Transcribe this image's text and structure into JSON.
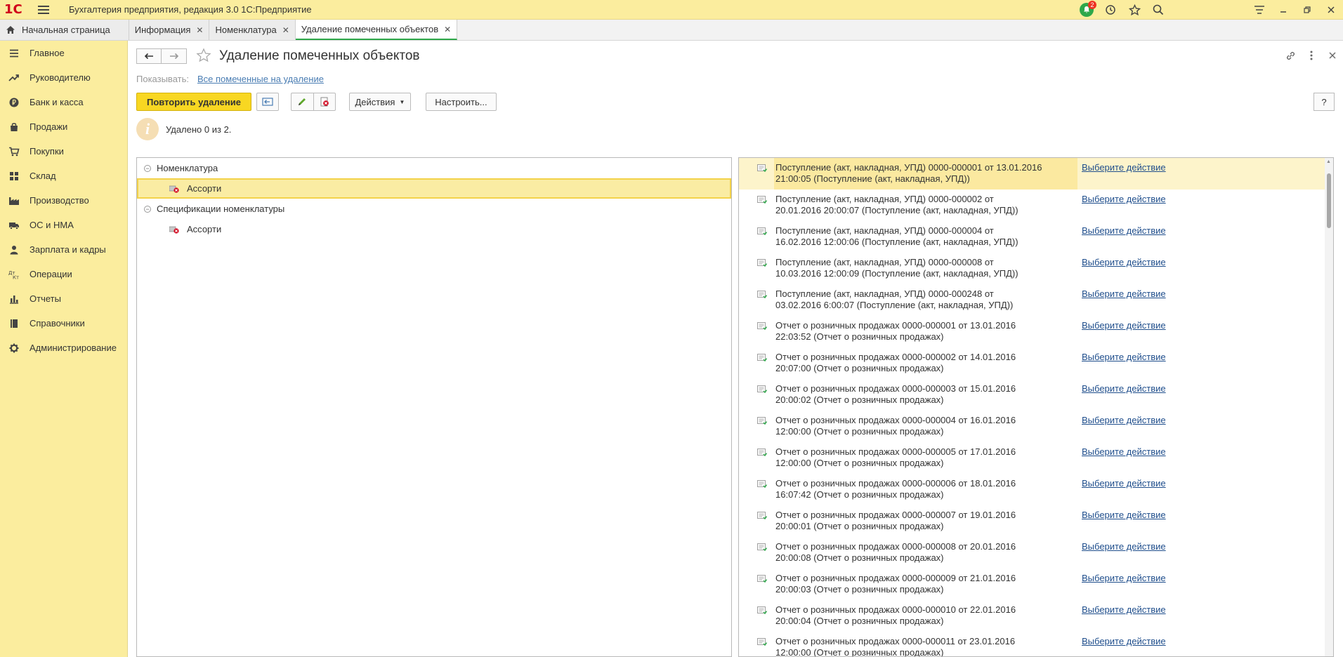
{
  "app": {
    "title": "Бухгалтерия предприятия, редакция 3.0 1С:Предприятие",
    "logo": "1С",
    "notifications_count": "2"
  },
  "tabs": [
    {
      "label": "Начальная страница"
    },
    {
      "label": "Информация"
    },
    {
      "label": "Номенклатура"
    },
    {
      "label": "Удаление помеченных объектов"
    }
  ],
  "sidebar": {
    "items": [
      {
        "label": "Главное",
        "icon": "menu-lines-icon"
      },
      {
        "label": "Руководителю",
        "icon": "trend-icon"
      },
      {
        "label": "Банк и касса",
        "icon": "ruble-icon"
      },
      {
        "label": "Продажи",
        "icon": "bag-icon"
      },
      {
        "label": "Покупки",
        "icon": "cart-icon"
      },
      {
        "label": "Склад",
        "icon": "grid-icon"
      },
      {
        "label": "Производство",
        "icon": "factory-icon"
      },
      {
        "label": "ОС и НМА",
        "icon": "truck-icon"
      },
      {
        "label": "Зарплата и кадры",
        "icon": "person-icon"
      },
      {
        "label": "Операции",
        "icon": "dt-kt-icon"
      },
      {
        "label": "Отчеты",
        "icon": "bar-chart-icon"
      },
      {
        "label": "Справочники",
        "icon": "book-icon"
      },
      {
        "label": "Администрирование",
        "icon": "gear-icon"
      }
    ]
  },
  "main": {
    "title": "Удаление помеченных объектов",
    "show_label": "Показывать:",
    "show_link": "Все помеченные на удаление",
    "toolbar": {
      "retry_label": "Повторить удаление",
      "actions_label": "Действия",
      "settings_label": "Настроить...",
      "help_label": "?"
    },
    "info_text": "Удалено 0 из 2.",
    "tree": [
      {
        "label": "Номенклатура",
        "level": 0
      },
      {
        "label": "Ассорти",
        "level": 1,
        "selected": true
      },
      {
        "label": "Спецификации номенклатуры",
        "level": 0
      },
      {
        "label": "Ассорти",
        "level": 1
      }
    ],
    "documents": [
      {
        "text": "Поступление (акт, накладная, УПД) 0000-000001 от 13.01.2016 21:00:05 (Поступление (акт, накладная, УПД))",
        "action": "Выберите действие"
      },
      {
        "text": "Поступление (акт, накладная, УПД) 0000-000002 от 20.01.2016 20:00:07 (Поступление (акт, накладная, УПД))",
        "action": "Выберите действие"
      },
      {
        "text": "Поступление (акт, накладная, УПД) 0000-000004 от 16.02.2016 12:00:06 (Поступление (акт, накладная, УПД))",
        "action": "Выберите действие"
      },
      {
        "text": "Поступление (акт, накладная, УПД) 0000-000008 от 10.03.2016 12:00:09 (Поступление (акт, накладная, УПД))",
        "action": "Выберите действие"
      },
      {
        "text": "Поступление (акт, накладная, УПД) 0000-000248 от 03.02.2016 6:00:07 (Поступление (акт, накладная, УПД))",
        "action": "Выберите действие"
      },
      {
        "text": "Отчет о розничных продажах 0000-000001 от 13.01.2016 22:03:52 (Отчет о розничных продажах)",
        "action": "Выберите действие"
      },
      {
        "text": "Отчет о розничных продажах 0000-000002 от 14.01.2016 20:07:00 (Отчет о розничных продажах)",
        "action": "Выберите действие"
      },
      {
        "text": "Отчет о розничных продажах 0000-000003 от 15.01.2016 20:00:02 (Отчет о розничных продажах)",
        "action": "Выберите действие"
      },
      {
        "text": "Отчет о розничных продажах 0000-000004 от 16.01.2016 12:00:00 (Отчет о розничных продажах)",
        "action": "Выберите действие"
      },
      {
        "text": "Отчет о розничных продажах 0000-000005 от 17.01.2016 12:00:00 (Отчет о розничных продажах)",
        "action": "Выберите действие"
      },
      {
        "text": "Отчет о розничных продажах 0000-000006 от 18.01.2016 16:07:42 (Отчет о розничных продажах)",
        "action": "Выберите действие"
      },
      {
        "text": "Отчет о розничных продажах 0000-000007 от 19.01.2016 20:00:01 (Отчет о розничных продажах)",
        "action": "Выберите действие"
      },
      {
        "text": "Отчет о розничных продажах 0000-000008 от 20.01.2016 20:00:08 (Отчет о розничных продажах)",
        "action": "Выберите действие"
      },
      {
        "text": "Отчет о розничных продажах 0000-000009 от 21.01.2016 20:00:03 (Отчет о розничных продажах)",
        "action": "Выберите действие"
      },
      {
        "text": "Отчет о розничных продажах 0000-000010 от 22.01.2016 20:00:04 (Отчет о розничных продажах)",
        "action": "Выберите действие"
      },
      {
        "text": "Отчет о розничных продажах 0000-000011 от 23.01.2016 12:00:00 (Отчет о розничных продажах)",
        "action": "Выберите действие"
      }
    ]
  }
}
